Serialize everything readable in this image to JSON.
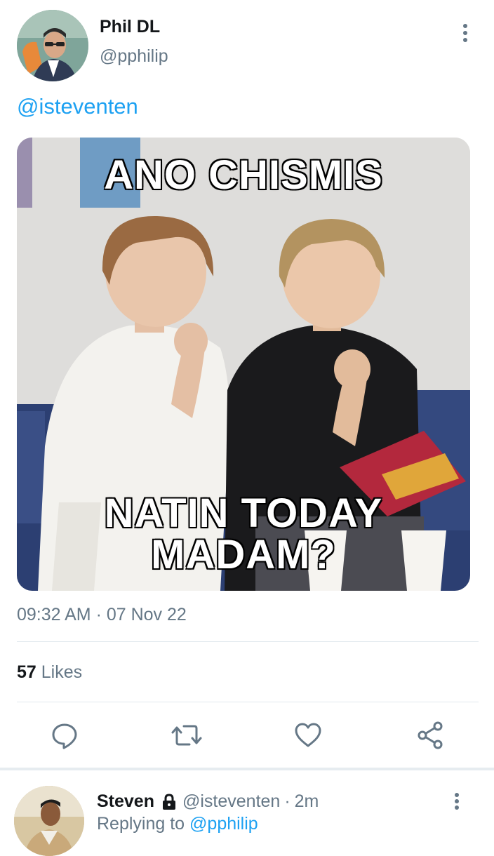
{
  "tweet": {
    "author_name": "Phil DL",
    "author_handle": "@pphilip",
    "text": "@isteventen",
    "media": {
      "caption_top": "ANO CHISMIS",
      "caption_bottom_line1": "NATIN TODAY",
      "caption_bottom_line2": "MADAM?"
    },
    "timestamp": "09:32 AM · 07 Nov 22",
    "likes_count": "57",
    "likes_label": "Likes",
    "actions": [
      {
        "name": "reply",
        "icon": "comment-icon"
      },
      {
        "name": "retweet",
        "icon": "retweet-icon"
      },
      {
        "name": "like",
        "icon": "heart-icon"
      },
      {
        "name": "share",
        "icon": "share-icon"
      }
    ]
  },
  "reply": {
    "author_name": "Steven",
    "author_handle": "@isteventen",
    "separator": "·",
    "time": "2m",
    "replying_prefix": "Replying to",
    "replying_to": "@pphilip"
  },
  "colors": {
    "link_blue": "#1da1f2",
    "secondary_text": "#657786",
    "primary_text": "#14171a",
    "divider": "#e1e8ed"
  }
}
